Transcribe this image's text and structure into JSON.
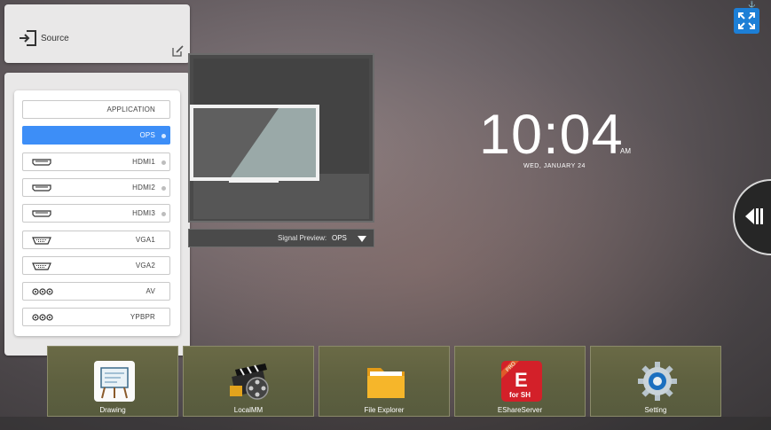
{
  "source_card": {
    "title": "Source"
  },
  "sources": [
    {
      "label": "APPLICATION",
      "port": "none",
      "active": false
    },
    {
      "label": "OPS",
      "port": "none",
      "active": true
    },
    {
      "label": "HDMI1",
      "port": "hdmi-port-icon",
      "active": false
    },
    {
      "label": "HDMI2",
      "port": "hdmi-port-icon",
      "active": false
    },
    {
      "label": "HDMI3",
      "port": "hdmi-port-icon",
      "active": false
    },
    {
      "label": "VGA1",
      "port": "vga-port-icon",
      "active": false
    },
    {
      "label": "VGA2",
      "port": "vga-port-icon",
      "active": false
    },
    {
      "label": "AV",
      "port": "av-port-icon",
      "active": false
    },
    {
      "label": "YPBPR",
      "port": "ypbpr-port-icon",
      "active": false
    }
  ],
  "preview": {
    "label": "Signal Preview:",
    "value": "OPS"
  },
  "clock": {
    "time": "10:04",
    "ampm": "AM",
    "date": "WED, JANUARY 24"
  },
  "apps": [
    {
      "label": "Drawing",
      "icon": "drawing-app-icon"
    },
    {
      "label": "LocalMM",
      "icon": "localmm-app-icon"
    },
    {
      "label": "File Explorer",
      "icon": "file-explorer-app-icon"
    },
    {
      "label": "EShareServer",
      "icon": "eshare-server-app-icon"
    },
    {
      "label": "Setting",
      "icon": "setting-app-icon"
    }
  ],
  "colors": {
    "accent": "#3d8ef7",
    "fullscreen": "#1d7fd6",
    "eshare": "#d32029"
  }
}
